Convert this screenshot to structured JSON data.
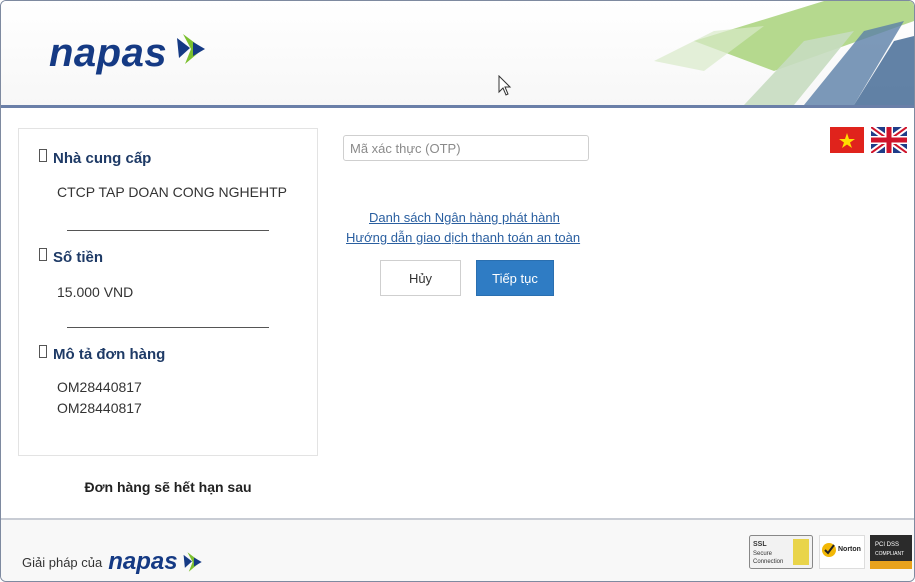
{
  "header": {
    "logo_text": "napas"
  },
  "summary": {
    "provider": {
      "label": "Nhà cung cấp",
      "value": "CTCP TAP DOAN CONG NGHEHTP"
    },
    "amount": {
      "label": "Số tiền",
      "value": "15.000 VND"
    },
    "description": {
      "label": "Mô tả đơn hàng",
      "lines": [
        "OM28440817",
        "OM28440817"
      ]
    },
    "expire_text": "Đơn hàng sẽ hết hạn sau"
  },
  "form": {
    "otp_placeholder": "Mã xác thực (OTP)",
    "otp_value": "",
    "link_banks": "Danh sách Ngân hàng phát hành",
    "link_guide": "Hướng dẫn giao dịch thanh toán an toàn",
    "cancel_label": "Hủy",
    "continue_label": "Tiếp tục"
  },
  "languages": [
    {
      "code": "vi",
      "icon": "vietnam-flag-icon"
    },
    {
      "code": "en",
      "icon": "uk-flag-icon"
    }
  ],
  "footer": {
    "powered_text": "Giải pháp của",
    "logo_text": "napas",
    "badges": [
      {
        "name": "ssl-secure-badge",
        "lines": [
          "SSL",
          "Secure",
          "Connection"
        ]
      },
      {
        "name": "norton-secured-badge",
        "text": "Norton"
      },
      {
        "name": "pci-dss-badge",
        "lines": [
          "PCI DSS",
          "COMPLIANT"
        ]
      }
    ]
  },
  "colors": {
    "brand_blue": "#153a84",
    "accent_green": "#7bbf2e",
    "button_blue": "#2f7cc4",
    "header_border": "#6a7fa8"
  }
}
